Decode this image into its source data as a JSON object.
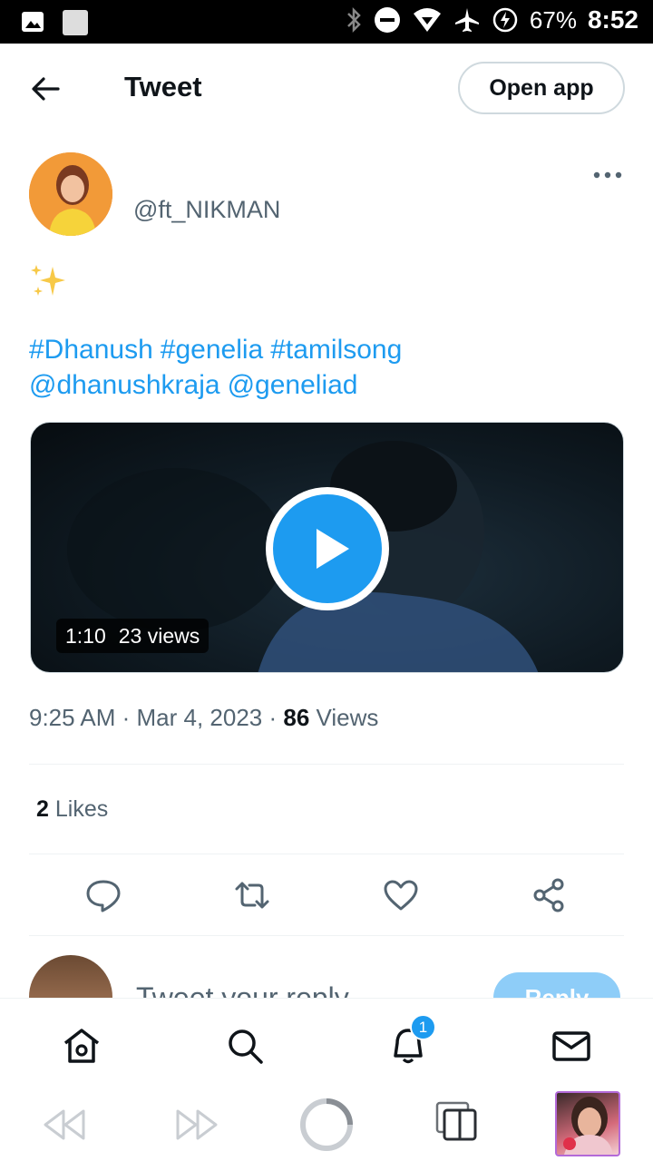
{
  "status_bar": {
    "battery": "67%",
    "time": "8:52"
  },
  "header": {
    "title": "Tweet",
    "open_app_label": "Open app"
  },
  "tweet": {
    "handle": "@ft_NIKMAN",
    "emoji": "sparkles",
    "hashtags": [
      "#Dhanush",
      "#genelia",
      "#tamilsong"
    ],
    "mentions": [
      "@dhanushkraja",
      "@geneliad"
    ],
    "video": {
      "duration": "1:10",
      "views": "23 views"
    },
    "time": "9:25 AM",
    "date": "Mar 4, 2023",
    "view_count": "86",
    "views_label": "Views",
    "likes_count": "2",
    "likes_label": "Likes"
  },
  "reply": {
    "placeholder": "Tweet your reply",
    "button_label": "Reply"
  },
  "bottom_nav": {
    "items": [
      "home-icon",
      "search-icon",
      "notifications-icon",
      "messages-icon"
    ],
    "notification_badge": "1"
  },
  "colors": {
    "accent": "#1d9bf0",
    "text_primary": "#0f1419",
    "text_secondary": "#536471"
  }
}
